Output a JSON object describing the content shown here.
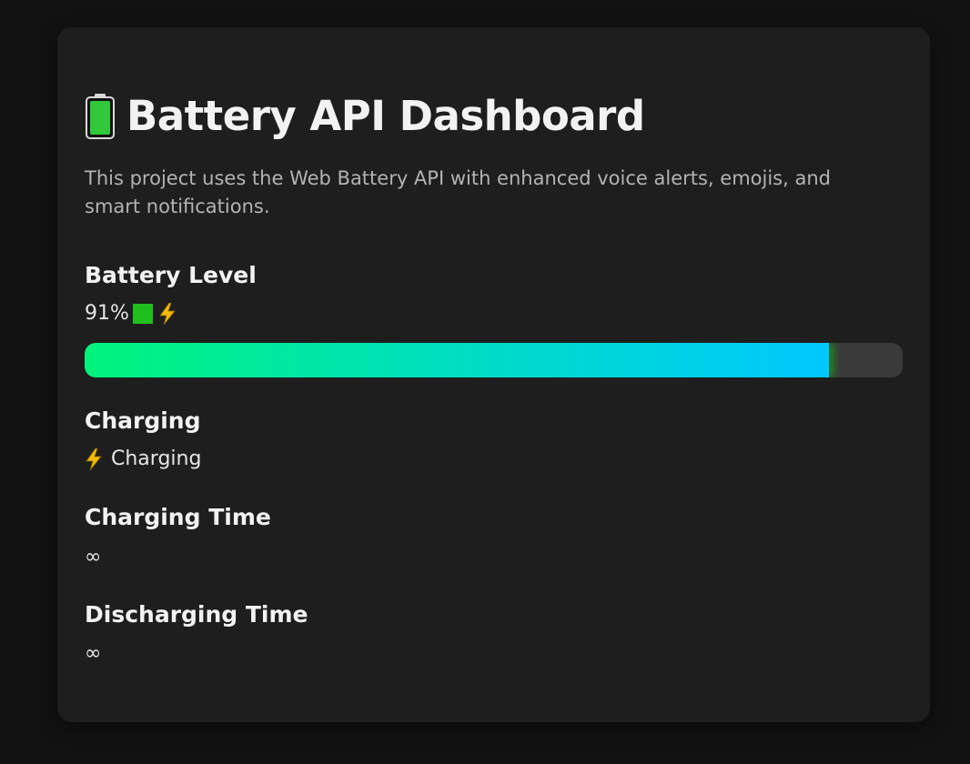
{
  "header": {
    "icon": "battery-icon",
    "title": "Battery API Dashboard",
    "description": "This project uses the Web Battery API with enhanced voice alerts, emojis, and smart notifications."
  },
  "battery_level": {
    "label": "Battery Level",
    "value_text": "91%",
    "level_fraction": 0.91,
    "status_icons": [
      "green-square-icon",
      "lightning-icon"
    ],
    "bar_colors": {
      "start": "#00f47c",
      "end": "#00c8ff",
      "track": "#3a3a3a"
    }
  },
  "charging": {
    "label": "Charging",
    "icon": "lightning-icon",
    "value": "Charging"
  },
  "charging_time": {
    "label": "Charging Time",
    "value": "∞"
  },
  "discharging_time": {
    "label": "Discharging Time",
    "value": "∞"
  },
  "colors": {
    "page_bg": "#121212",
    "card_bg": "#1e1e1e",
    "accent_green": "#1fbf1f",
    "bolt": "#f5b800"
  }
}
